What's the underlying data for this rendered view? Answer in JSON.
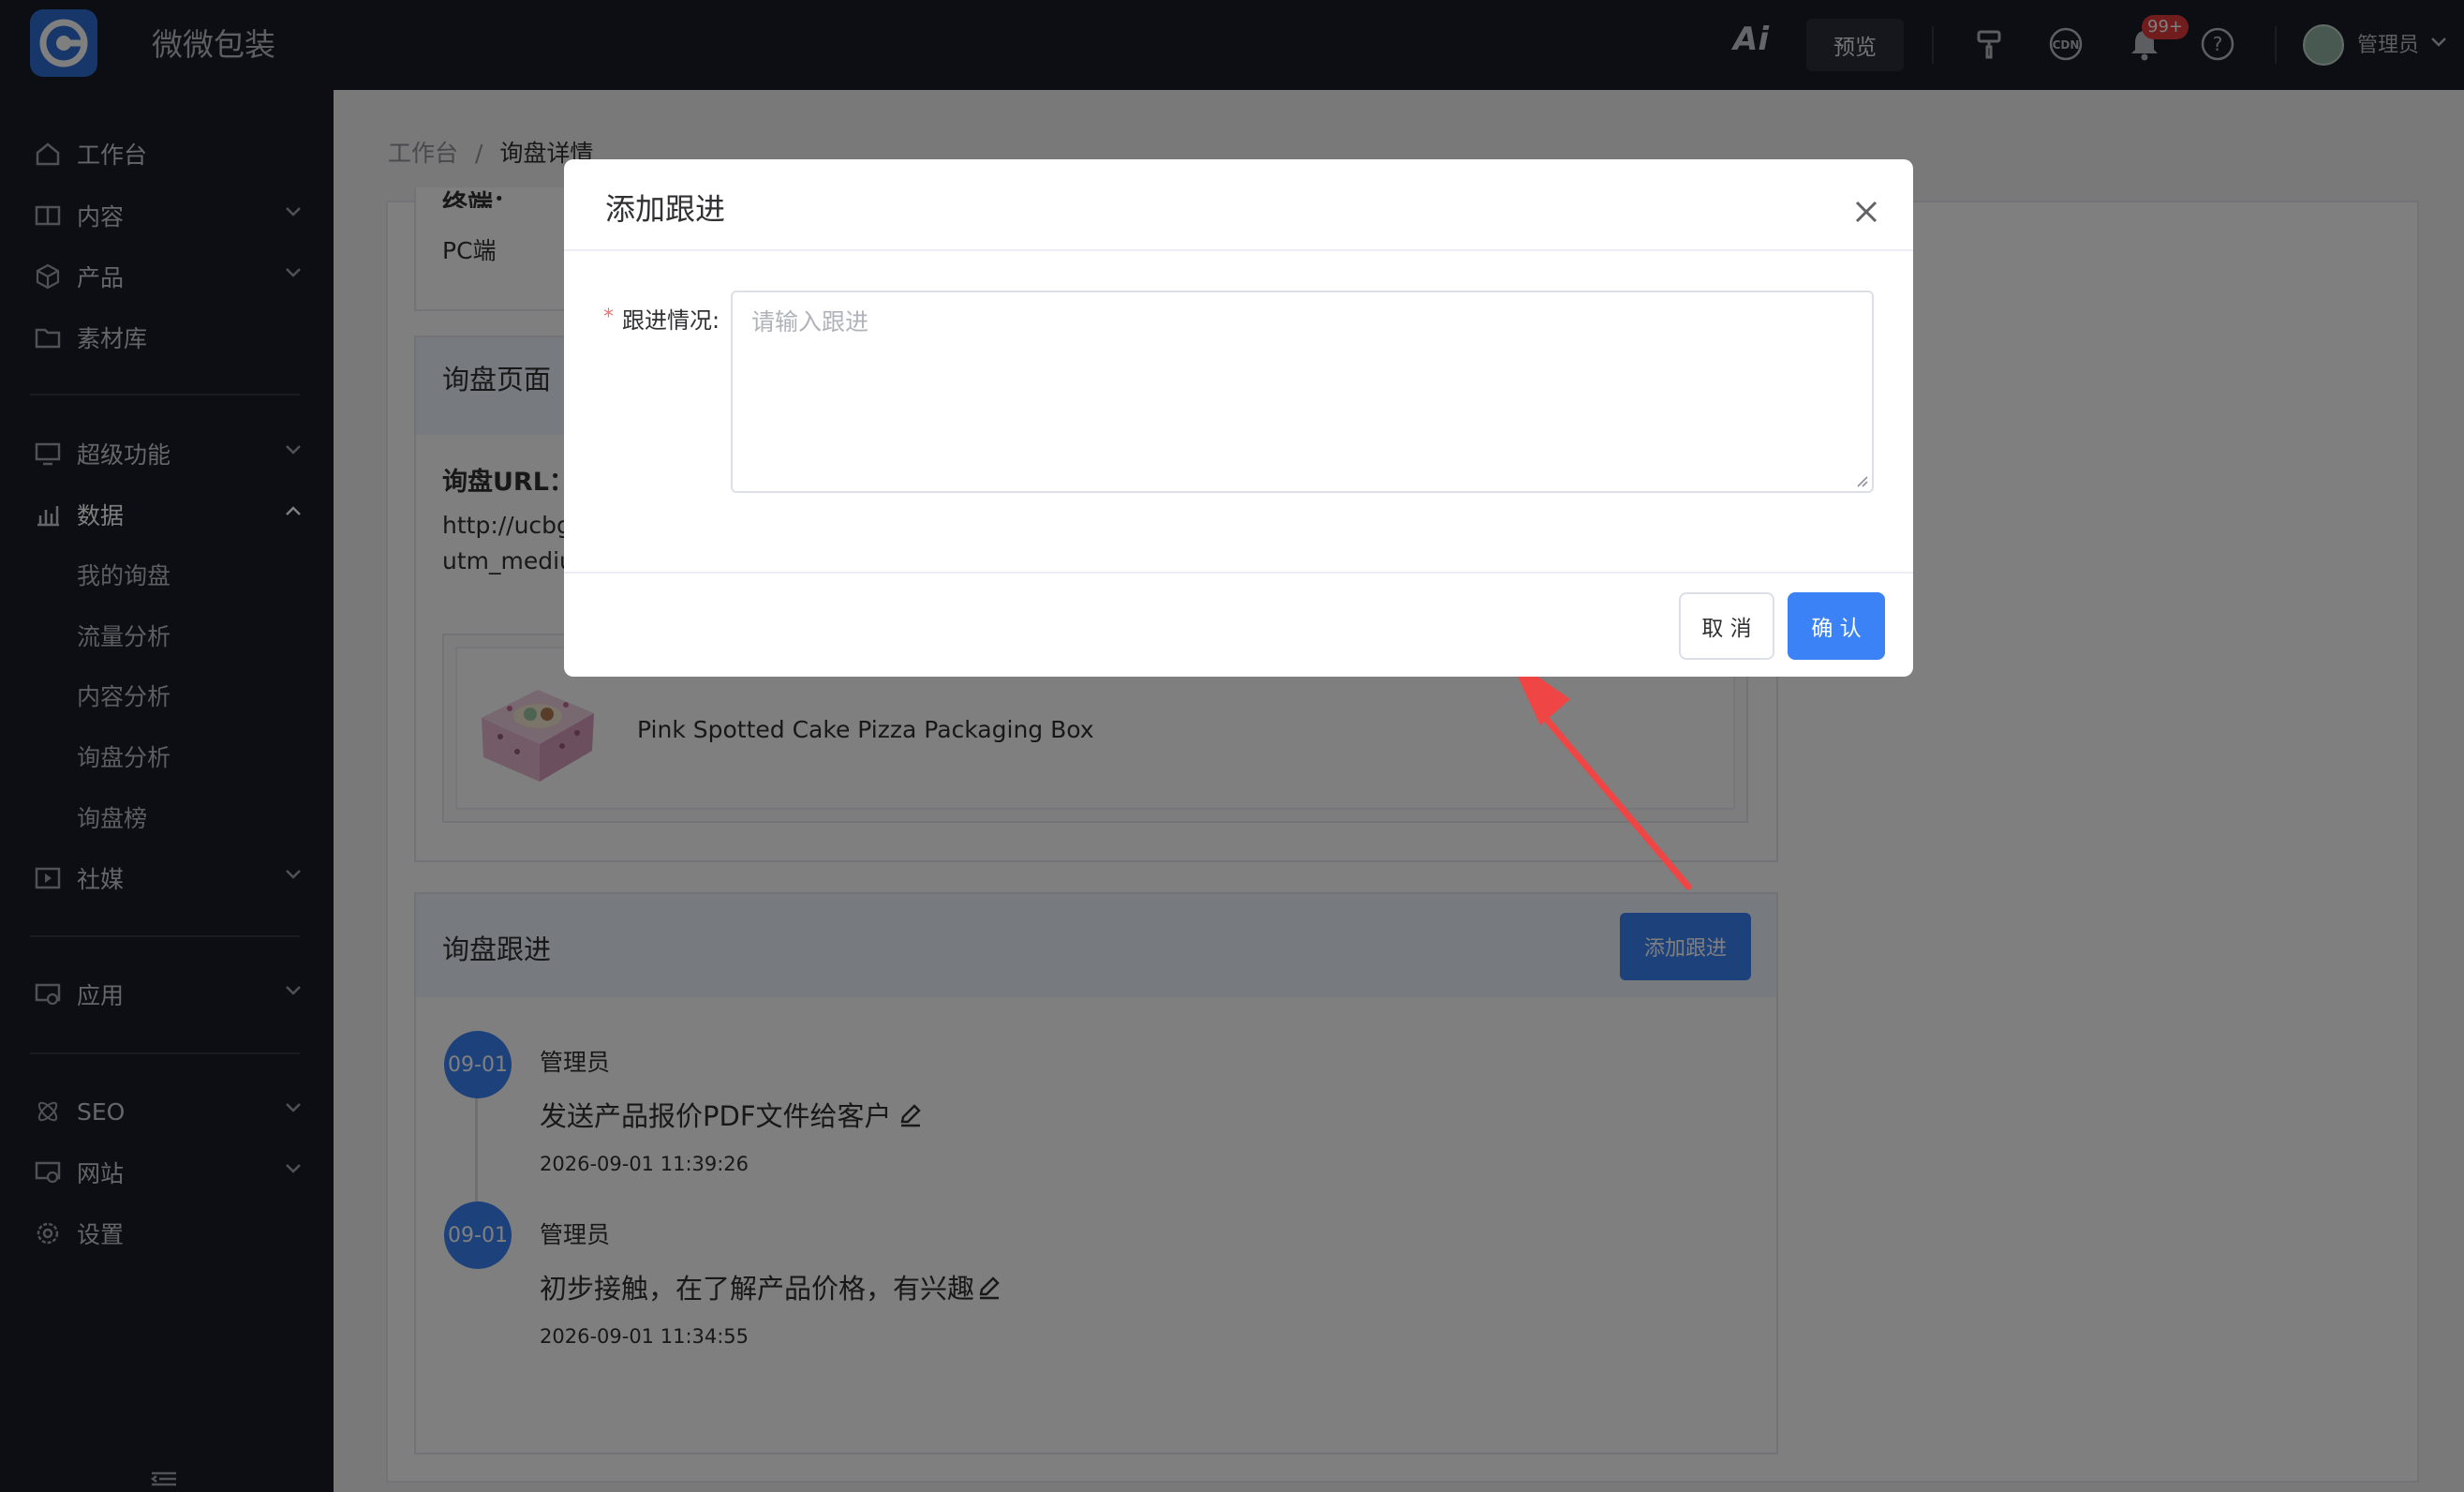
{
  "app": {
    "title": "微微包装"
  },
  "topbar": {
    "ai_label": "Ai",
    "preview_label": "预览",
    "notification_badge": "99+",
    "user_name": "管理员",
    "icons": [
      "paint-roller-icon",
      "cdn-icon",
      "bell-icon",
      "help-icon",
      "chevron-down-icon"
    ]
  },
  "sidebar": {
    "items": [
      {
        "label": "工作台",
        "icon": "home-icon"
      },
      {
        "label": "内容",
        "icon": "book-icon"
      },
      {
        "label": "产品",
        "icon": "box-icon"
      },
      {
        "label": "素材库",
        "icon": "folder-icon"
      },
      {
        "label": "超级功能",
        "icon": "monitor-icon"
      },
      {
        "label": "数据",
        "icon": "chart-icon"
      },
      {
        "label": "社媒",
        "icon": "video-icon"
      },
      {
        "label": "应用",
        "icon": "app-icon"
      },
      {
        "label": "SEO",
        "icon": "atom-icon"
      },
      {
        "label": "网站",
        "icon": "website-icon"
      },
      {
        "label": "设置",
        "icon": "gear-icon"
      }
    ],
    "data_sub": [
      "我的询盘",
      "流量分析",
      "内容分析",
      "询盘分析",
      "询盘榜"
    ]
  },
  "breadcrumb": {
    "home": "工作台",
    "sep": "/",
    "current": "询盘详情"
  },
  "detail": {
    "partial_label": "终端：",
    "terminal_value": "PC端",
    "page_section_title": "询盘页面",
    "url_label": "询盘URL：",
    "url_line1": "http://ucbgbi",
    "url_line2": "utm_mediun",
    "product_name": "Pink Spotted Cake Pizza Packaging Box"
  },
  "followup": {
    "title": "询盘跟进",
    "add_button": "添加跟进",
    "entries": [
      {
        "date_badge": "09-01",
        "author": "管理员",
        "text": "发送产品报价PDF文件给客户",
        "time": "2026-09-01 11:39:26"
      },
      {
        "date_badge": "09-01",
        "author": "管理员",
        "text": "初步接触，在了解产品价格，有兴趣",
        "time": "2026-09-01 11:34:55"
      }
    ]
  },
  "modal": {
    "title": "添加跟进",
    "field_label": "跟进情况:",
    "required_mark": "*",
    "placeholder": "请输入跟进",
    "cancel": "取 消",
    "confirm": "确 认"
  },
  "colors": {
    "primary": "#3b82f6",
    "sidebar_bg": "#191c26",
    "danger": "#e53a3a"
  }
}
